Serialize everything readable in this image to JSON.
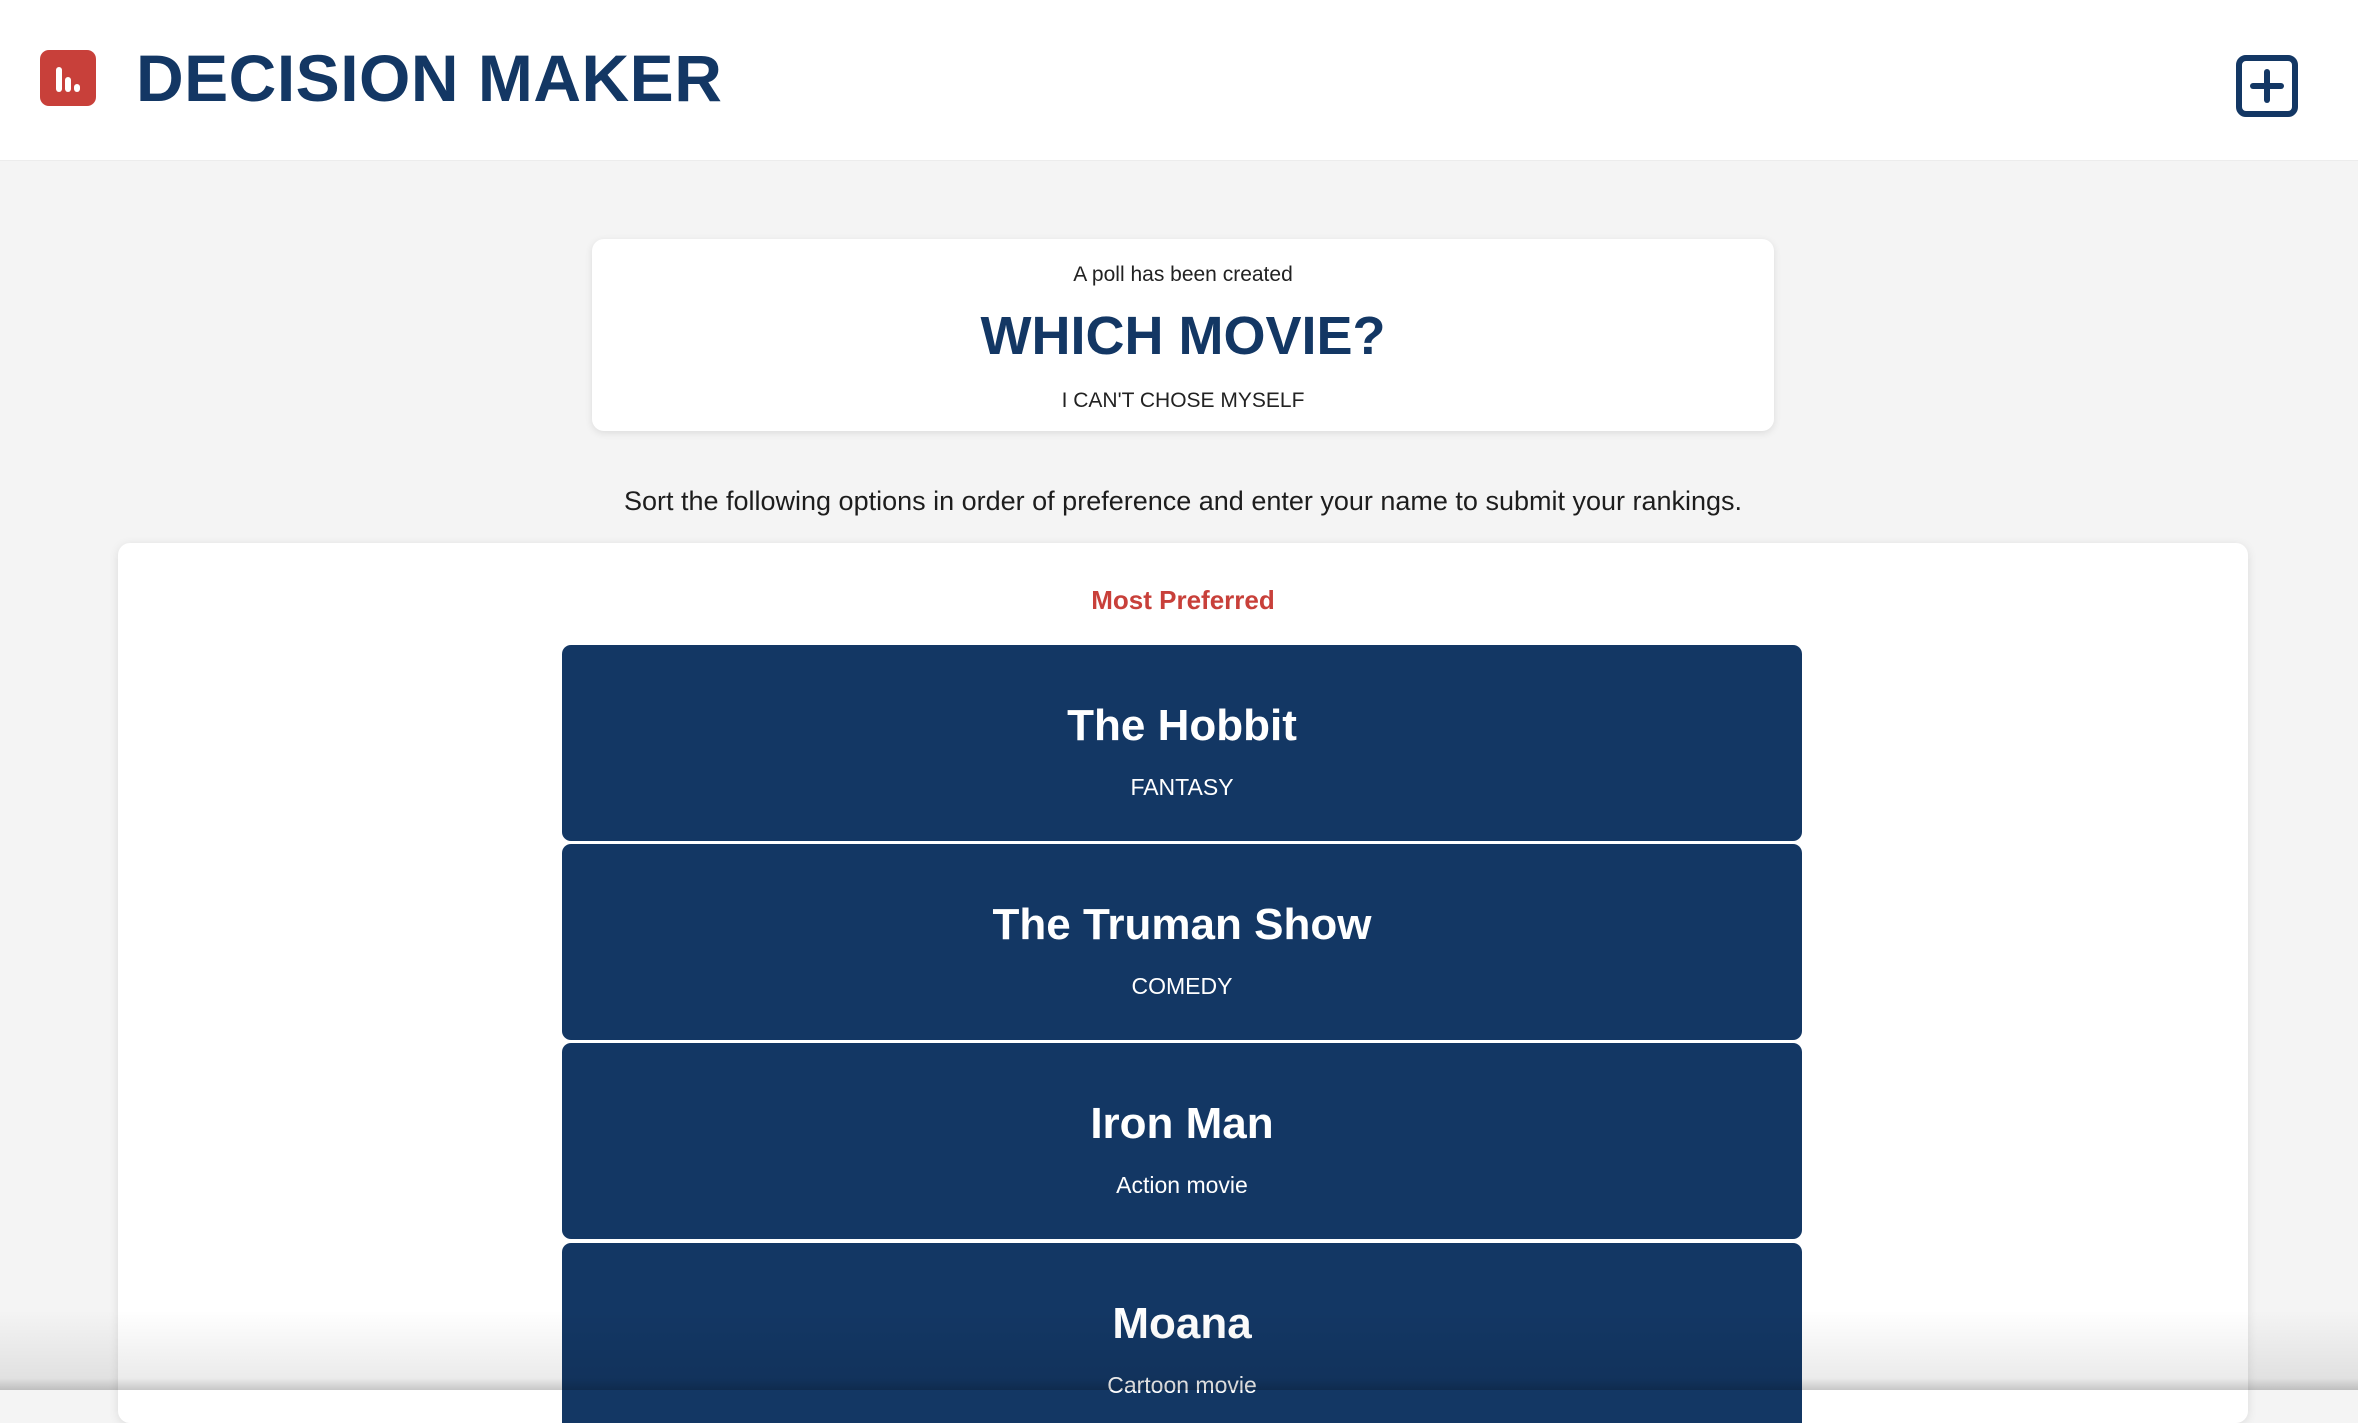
{
  "app": {
    "title": "DECISION MAKER",
    "logo_icon": "bar-chart-icon",
    "add_icon": "plus-square-icon",
    "colors": {
      "brand_navy": "#133764",
      "accent_red": "#c8403a",
      "background": "#f4f4f4"
    }
  },
  "poll": {
    "notice": "A poll has been created",
    "title": "WHICH MOVIE?",
    "description": "I CAN'T CHOSE MYSELF"
  },
  "instructions": "Sort the following options in order of preference and enter your name to submit your rankings.",
  "ranking": {
    "top_label": "Most Preferred",
    "options": [
      {
        "name": "The Hobbit",
        "category": "FANTASY"
      },
      {
        "name": "The Truman Show",
        "category": "COMEDY"
      },
      {
        "name": "Iron Man",
        "category": "Action movie"
      },
      {
        "name": "Moana",
        "category": "Cartoon movie"
      }
    ]
  }
}
